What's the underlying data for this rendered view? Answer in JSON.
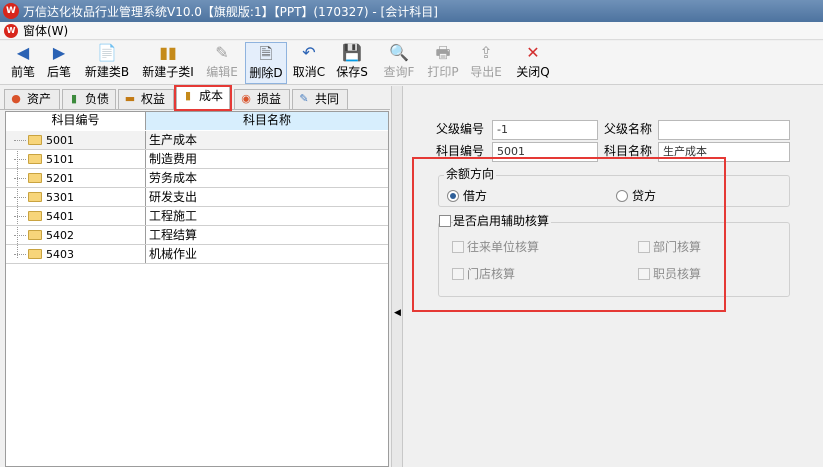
{
  "window": {
    "title": "万信达化妆品行业管理系统V10.0【旗舰版:1】【PPT】(170327) - [会计科目]"
  },
  "menu": {
    "items": [
      "窗体(W)"
    ]
  },
  "toolbar": {
    "buttons": [
      {
        "label": "前笔",
        "icon": "arrow-left-icon"
      },
      {
        "label": "后笔",
        "icon": "arrow-right-icon"
      },
      {
        "label": "新建类B",
        "icon": "new-doc-icon"
      },
      {
        "label": "新建子类I",
        "icon": "bar-chart-icon"
      },
      {
        "label": "编辑E",
        "icon": "edit-icon"
      },
      {
        "label": "删除D",
        "icon": "delete-doc-icon"
      },
      {
        "label": "取消C",
        "icon": "undo-icon"
      },
      {
        "label": "保存S",
        "icon": "save-icon"
      },
      {
        "label": "查询F",
        "icon": "search-doc-icon"
      },
      {
        "label": "打印P",
        "icon": "print-icon"
      },
      {
        "label": "导出E",
        "icon": "export-icon"
      },
      {
        "label": "关闭Q",
        "icon": "close-icon"
      }
    ]
  },
  "tabs": [
    {
      "label": "资产",
      "icon": "asset-icon"
    },
    {
      "label": "负债",
      "icon": "liability-icon"
    },
    {
      "label": "权益",
      "icon": "equity-icon"
    },
    {
      "label": "成本",
      "icon": "cost-chart-icon",
      "selected": true
    },
    {
      "label": "损益",
      "icon": "profit-loss-icon"
    },
    {
      "label": "共同",
      "icon": "common-icon"
    }
  ],
  "grid": {
    "columns": [
      "科目编号",
      "科目名称"
    ],
    "rows": [
      {
        "code": "5001",
        "name": "生产成本"
      },
      {
        "code": "5101",
        "name": "制造费用"
      },
      {
        "code": "5201",
        "name": "劳务成本"
      },
      {
        "code": "5301",
        "name": "研发支出"
      },
      {
        "code": "5401",
        "name": "工程施工"
      },
      {
        "code": "5402",
        "name": "工程结算"
      },
      {
        "code": "5403",
        "name": "机械作业"
      }
    ]
  },
  "form": {
    "parent_code_label": "父级编号",
    "parent_code_value": "-1",
    "parent_name_label": "父级名称",
    "parent_name_value": "",
    "code_label": "科目编号",
    "code_value": "5001",
    "name_label": "科目名称",
    "name_value": "生产成本",
    "balance_group_title": "余额方向",
    "debit_label": "借方",
    "credit_label": "贷方",
    "aux_enable_label": "是否启用辅助核算",
    "aux_options": [
      "往来单位核算",
      "部门核算",
      "门店核算",
      "职员核算"
    ]
  }
}
